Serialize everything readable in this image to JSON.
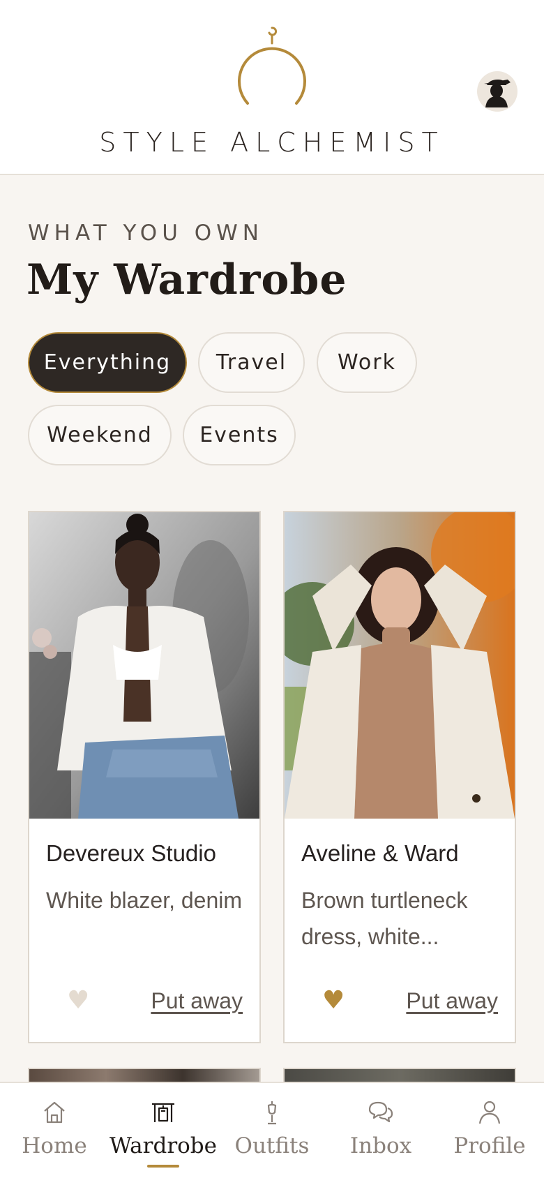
{
  "app": {
    "brand": "STYLE ALCHEMIST"
  },
  "section": {
    "eyebrow": "WHAT YOU OWN",
    "title": "My Wardrobe"
  },
  "filters": [
    {
      "label": "Everything",
      "active": true
    },
    {
      "label": "Travel",
      "active": false
    },
    {
      "label": "Work",
      "active": false
    },
    {
      "label": "Weekend",
      "active": false
    },
    {
      "label": "Events",
      "active": false
    }
  ],
  "cards": [
    {
      "brand": "Devereux Studio",
      "description": "White blazer, denim",
      "favorite": false,
      "action": "Put away"
    },
    {
      "brand": "Aveline & Ward",
      "description": "Brown turtleneck dress, white...",
      "favorite": true,
      "action": "Put away"
    }
  ],
  "nav": {
    "items": [
      {
        "label": "Home",
        "icon": "home-icon",
        "active": false
      },
      {
        "label": "Wardrobe",
        "icon": "wardrobe-icon",
        "active": true
      },
      {
        "label": "Outfits",
        "icon": "mannequin-icon",
        "active": false
      },
      {
        "label": "Inbox",
        "icon": "chat-bubbles-icon",
        "active": false
      },
      {
        "label": "Profile",
        "icon": "person-icon",
        "active": false
      }
    ]
  },
  "colors": {
    "accent": "#b48a3a",
    "background": "#f8f5f1",
    "dark": "#2e2824",
    "heart_inactive": "#e4dbd0",
    "heart_active": "#b48a3a"
  }
}
